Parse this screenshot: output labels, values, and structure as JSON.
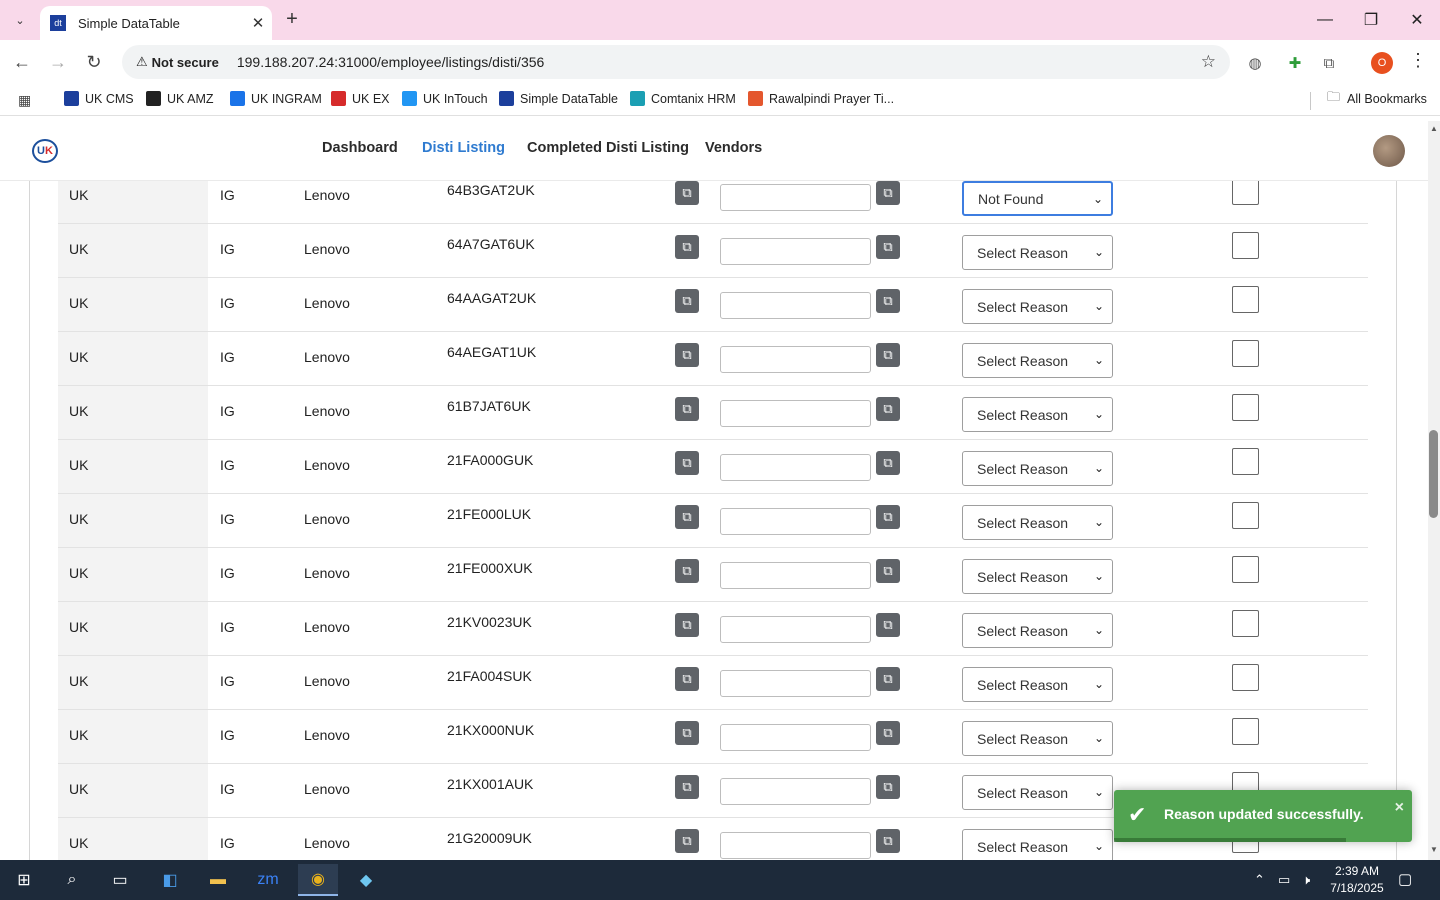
{
  "browser": {
    "tab_title": "Simple DataTable",
    "tab_favicon_text": "dt",
    "security_label": "Not secure",
    "url": "199.188.207.24:31000/employee/listings/disti/356",
    "profile_initial": "O",
    "bookmarks": [
      {
        "label": "UK CMS",
        "icon_color": "#1c3f9c",
        "icon": "uk-cms-icon"
      },
      {
        "label": "UK AMZ",
        "icon_color": "#222222",
        "icon": "amazon-icon"
      },
      {
        "label": "UK INGRAM",
        "icon_color": "#1a73e8",
        "icon": "ingram-icon"
      },
      {
        "label": "UK EX",
        "icon_color": "#d62b2b",
        "icon": "ex-icon"
      },
      {
        "label": "UK InTouch",
        "icon_color": "#2196f3",
        "icon": "intouch-icon"
      },
      {
        "label": "Simple DataTable",
        "icon_color": "#1c3f9c",
        "icon": "datatable-icon"
      },
      {
        "label": "Comtanix HRM",
        "icon_color": "#1b9fb3",
        "icon": "comtanix-icon"
      },
      {
        "label": "Rawalpindi Prayer Ti...",
        "icon_color": "#e4572e",
        "icon": "prayer-icon"
      }
    ],
    "all_bookmarks_label": "All Bookmarks"
  },
  "app": {
    "logo_text": "UK",
    "nav": [
      "Dashboard",
      "Disti Listing",
      "Completed Disti Listing",
      "Vendors"
    ],
    "active_nav": "Disti Listing"
  },
  "table": {
    "rows": [
      {
        "country": "UK",
        "distributor": "IG",
        "brand": "Lenovo",
        "part": "64B3GAT2UK",
        "reason": "Not Found"
      },
      {
        "country": "UK",
        "distributor": "IG",
        "brand": "Lenovo",
        "part": "64A7GAT6UK",
        "reason": "Select Reason"
      },
      {
        "country": "UK",
        "distributor": "IG",
        "brand": "Lenovo",
        "part": "64AAGAT2UK",
        "reason": "Select Reason"
      },
      {
        "country": "UK",
        "distributor": "IG",
        "brand": "Lenovo",
        "part": "64AEGAT1UK",
        "reason": "Select Reason"
      },
      {
        "country": "UK",
        "distributor": "IG",
        "brand": "Lenovo",
        "part": "61B7JAT6UK",
        "reason": "Select Reason"
      },
      {
        "country": "UK",
        "distributor": "IG",
        "brand": "Lenovo",
        "part": "21FA000GUK",
        "reason": "Select Reason"
      },
      {
        "country": "UK",
        "distributor": "IG",
        "brand": "Lenovo",
        "part": "21FE000LUK",
        "reason": "Select Reason"
      },
      {
        "country": "UK",
        "distributor": "IG",
        "brand": "Lenovo",
        "part": "21FE000XUK",
        "reason": "Select Reason"
      },
      {
        "country": "UK",
        "distributor": "IG",
        "brand": "Lenovo",
        "part": "21KV0023UK",
        "reason": "Select Reason"
      },
      {
        "country": "UK",
        "distributor": "IG",
        "brand": "Lenovo",
        "part": "21FA004SUK",
        "reason": "Select Reason"
      },
      {
        "country": "UK",
        "distributor": "IG",
        "brand": "Lenovo",
        "part": "21KX000NUK",
        "reason": "Select Reason"
      },
      {
        "country": "UK",
        "distributor": "IG",
        "brand": "Lenovo",
        "part": "21KX001AUK",
        "reason": "Select Reason"
      },
      {
        "country": "UK",
        "distributor": "IG",
        "brand": "Lenovo",
        "part": "21G20009UK",
        "reason": "Select Reason"
      }
    ]
  },
  "toast": {
    "message": "Reason updated successfully.",
    "close": "×",
    "progress": 0.78,
    "color": "#51a351"
  },
  "taskbar": {
    "time": "2:39 AM",
    "date": "7/18/2025"
  },
  "colors": {
    "tabstrip": "#f9d9ea",
    "active_nav": "#2f7bd0",
    "focused_select_border": "#3d7de0"
  }
}
